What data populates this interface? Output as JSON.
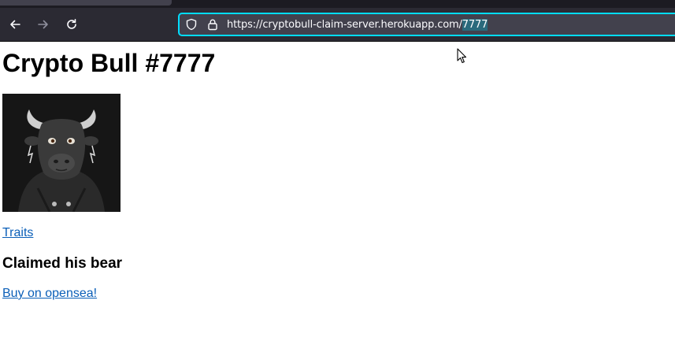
{
  "browser": {
    "url_prefix": "https://cryptobull-claim-server.herokuapp.com/",
    "url_selected": "7777"
  },
  "page": {
    "title": "Crypto Bull #7777",
    "image_alt": "Crypto Bull #7777 image",
    "traits_link": "Traits",
    "status_heading": "Claimed his bear",
    "buy_link": "Buy on opensea!"
  },
  "colors": {
    "link": "#0b5fb8",
    "urlbar_focus": "#00ddff",
    "toolbar": "#2b2a33"
  },
  "icons": [
    "back-arrow-icon",
    "forward-arrow-icon",
    "reload-icon",
    "shield-icon",
    "lock-icon",
    "mouse-cursor-icon"
  ]
}
